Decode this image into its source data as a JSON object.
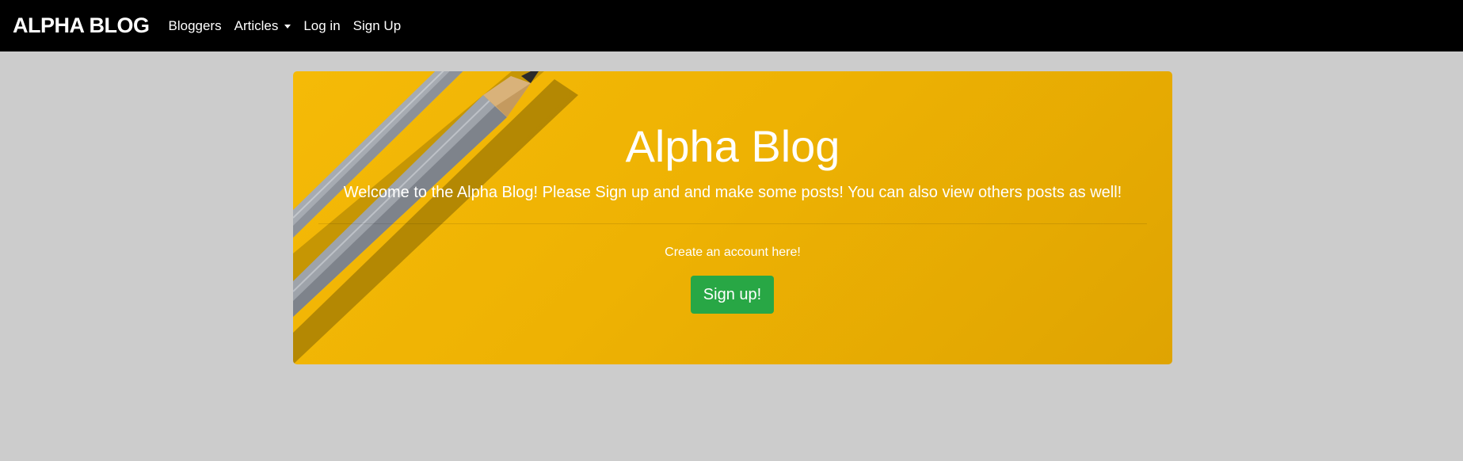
{
  "navbar": {
    "brand": "ALPHA BLOG",
    "items": [
      {
        "label": "Bloggers"
      },
      {
        "label": "Articles",
        "dropdown": true
      },
      {
        "label": "Log in"
      },
      {
        "label": "Sign Up"
      }
    ]
  },
  "hero": {
    "title": "Alpha Blog",
    "lead": "Welcome to the Alpha Blog! Please Sign up and and make some posts! You can also view others posts as well!",
    "cta_text": "Create an account here!",
    "button_label": "Sign up!"
  },
  "colors": {
    "navbar_bg": "#000000",
    "page_bg": "#cccccc",
    "hero_bg": "#eeb203",
    "button_bg": "#28a745",
    "text": "#ffffff"
  },
  "icons": {
    "dropdown": "caret-down-icon",
    "hero_image": "pencils-illustration"
  }
}
